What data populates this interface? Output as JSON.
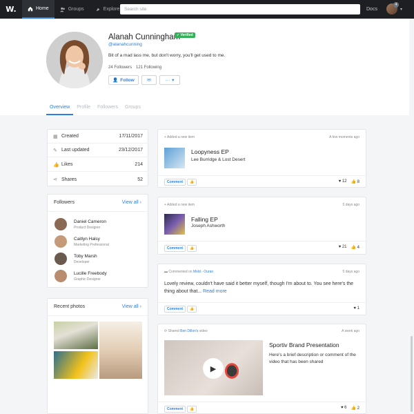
{
  "nav": {
    "logo": "W.",
    "tabs": [
      {
        "label": "Home",
        "icon": "home-icon"
      },
      {
        "label": "Groups",
        "icon": "groups-icon"
      },
      {
        "label": "Explore",
        "icon": "compass-icon"
      }
    ],
    "search_placeholder": "Search site",
    "docs": "Docs",
    "badge": "4",
    "accent": "#2a7fe0"
  },
  "profile": {
    "name": "Alanah Cunningham",
    "verified": "Verified",
    "handle": "@alanahcunning",
    "bio": "Bit of a mad lass me, but don't worry, you'll get used to me.",
    "followers": "24 Followers",
    "following": "121 Following",
    "follow_label": "Follow",
    "more_label": "···"
  },
  "tabs": [
    "Overview",
    "Profile",
    "Followers",
    "Groups"
  ],
  "info": [
    {
      "label": "Created",
      "value": "17/11/2017",
      "icon": "calendar-icon"
    },
    {
      "label": "Last updated",
      "value": "23/12/2017",
      "icon": "pencil-icon"
    },
    {
      "label": "Likes",
      "value": "214",
      "icon": "thumbs-up-icon"
    },
    {
      "label": "Shares",
      "value": "52",
      "icon": "share-icon"
    }
  ],
  "followers_card": {
    "title": "Followers",
    "view_all": "View all ›",
    "people": [
      {
        "name": "Daniel Cameron",
        "role": "Product Designer",
        "color": "#8a6a52"
      },
      {
        "name": "Caitlyn Halsy",
        "role": "Marketing Professional",
        "color": "#c49a78"
      },
      {
        "name": "Toby Marsh",
        "role": "Developer",
        "color": "#6b5a4e"
      },
      {
        "name": "Lucille Freebody",
        "role": "Graphic Designer",
        "color": "#b88c6c"
      }
    ]
  },
  "photos_card": {
    "title": "Recent photos",
    "view_all": "View all ›"
  },
  "feed": [
    {
      "meta": "Added a new item",
      "time": "A few moments ago",
      "title": "Loopyness EP",
      "subtitle": "Lee Burridge & Lost Desert",
      "comment": "Comment",
      "hearts": "12",
      "likes": "8"
    },
    {
      "meta": "Added a new item",
      "time": "5 days ago",
      "title": "Falling EP",
      "subtitle": "Joseph Ashworth",
      "comment": "Comment",
      "hearts": "21",
      "likes": "4"
    },
    {
      "meta_prefix": "Commented on",
      "meta_link": "Mold - Ouran",
      "time": "5 days ago",
      "body": "Lovely review, couldn't have said it better myself, though I'm about to. You see here's the thing about that...",
      "read_more": "Read more",
      "comment": "Comment",
      "hearts": "1"
    },
    {
      "meta_prefix": "Shared",
      "meta_link": "Ben Dillon's",
      "meta_suffix": "video",
      "time": "A week ago",
      "title": "Sportiv Brand Presentation",
      "body": "Here's a brief description or comment of the video that has been shared",
      "comment": "Comment",
      "hearts": "6",
      "likes": "2"
    }
  ]
}
